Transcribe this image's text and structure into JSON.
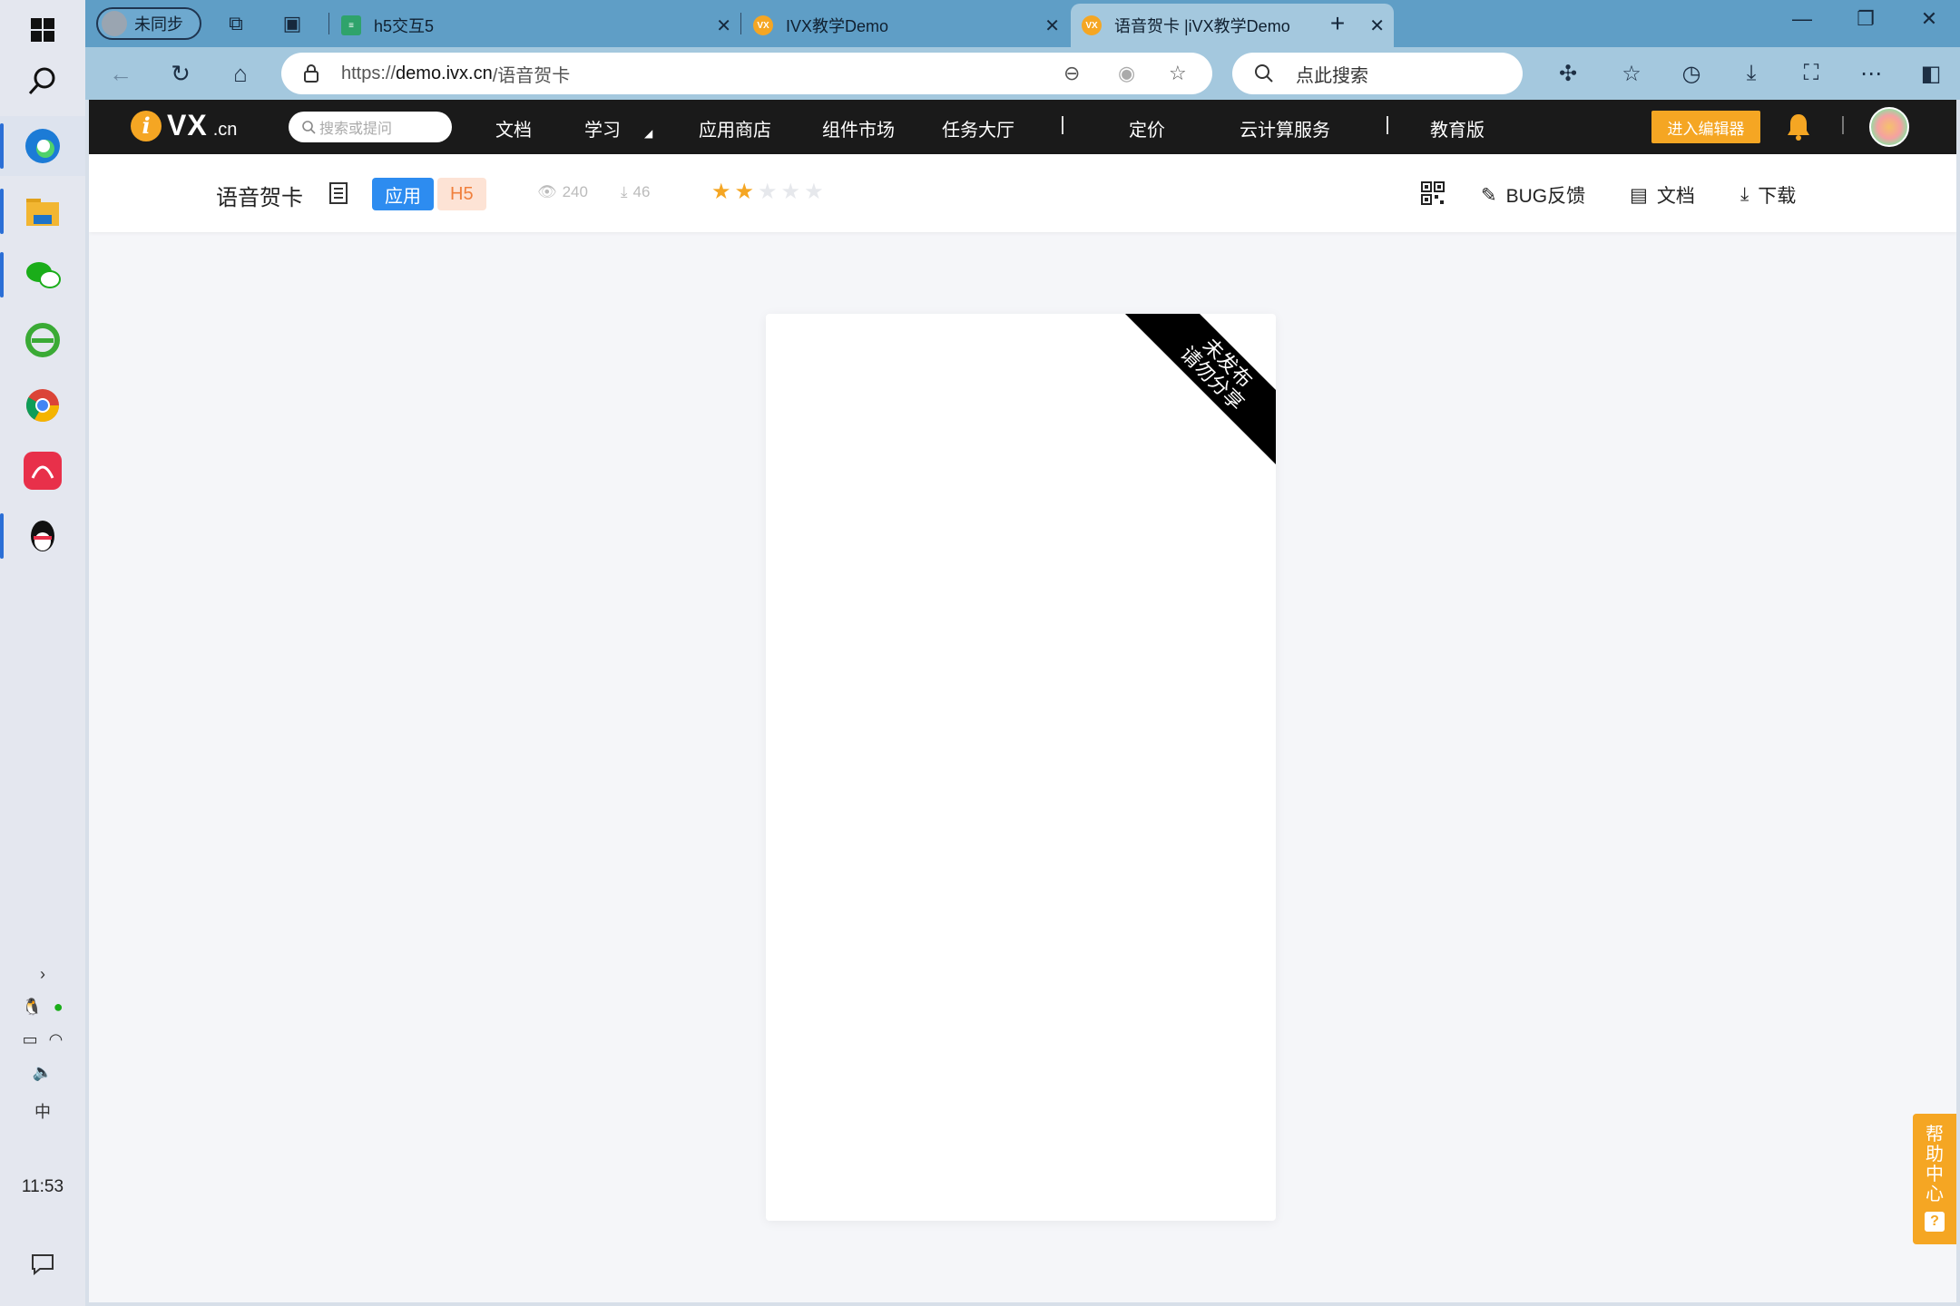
{
  "taskbar": {
    "apps": [
      {
        "name": "edge",
        "color": "#1c7bd6"
      },
      {
        "name": "file-explorer",
        "color": "#f2b632"
      },
      {
        "name": "wechat",
        "color": "#1aad19"
      },
      {
        "name": "ie",
        "color": "#3aaa35"
      },
      {
        "name": "chrome",
        "color": "#db4437"
      },
      {
        "name": "app-red",
        "color": "#e8304a"
      },
      {
        "name": "qq",
        "color": "#111111"
      }
    ],
    "ime": "中",
    "clock": "11:53"
  },
  "browser": {
    "profile_label": "未同步",
    "tabs": [
      {
        "title": "h5交互5"
      },
      {
        "title": "IVX教学Demo"
      },
      {
        "title": "语音贺卡 |iVX教学Demo"
      }
    ],
    "url_prefix": "https://",
    "url_domain": "demo.ivx.cn",
    "url_path": "/语音贺卡",
    "search_placeholder": "点此搜索"
  },
  "ivx_nav": {
    "logo_vx": "VX",
    "logo_cn": ".cn",
    "search_placeholder": "搜索或提问",
    "menu": [
      "文档",
      "学习",
      "应用商店",
      "组件市场",
      "任务大厅",
      "定价",
      "云计算服务",
      "教育版"
    ],
    "editor_button": "进入编辑器"
  },
  "app_bar": {
    "title": "语音贺卡",
    "badge_type": "应用",
    "badge_platform": "H5",
    "views": "240",
    "downloads": "46",
    "rating": 2,
    "rating_max": 5,
    "actions": {
      "bug": "BUG反馈",
      "docs": "文档",
      "download": "下载"
    }
  },
  "preview": {
    "ribbon_line1": "未发布",
    "ribbon_line2": "请勿分享"
  },
  "help": {
    "label_chars": [
      "帮",
      "助",
      "中",
      "心"
    ],
    "icon": "?"
  },
  "colors": {
    "accent_orange": "#f5a623",
    "badge_blue": "#2d8cf0"
  }
}
